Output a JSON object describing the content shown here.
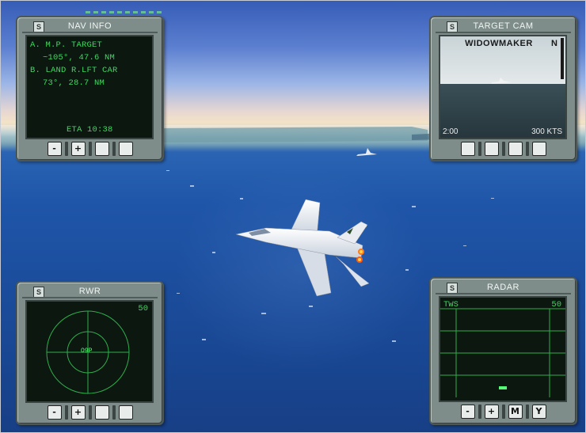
{
  "hud": {
    "nav_info": {
      "title": "NAV INFO",
      "panel_key": "S",
      "line_a1": "A. M.P. TARGET",
      "line_a2": "~105°, 47.6 NM",
      "line_b1": "B. LAND R.LFT CAR",
      "line_b2": "73°, 28.7 NM",
      "eta": "ETA 10:38",
      "buttons": [
        "-",
        "+",
        "",
        ""
      ]
    },
    "target_cam": {
      "title": "TARGET CAM",
      "panel_key": "S",
      "target_name": "WIDOWMAKER",
      "heading_marker": "N",
      "time": "2:00",
      "speed": "300 KTS",
      "buttons": [
        "",
        "",
        "",
        ""
      ]
    },
    "rwr": {
      "title": "RWR",
      "panel_key": "S",
      "range": "50",
      "contact_label": "O9P",
      "buttons": [
        "-",
        "+",
        "",
        ""
      ]
    },
    "radar": {
      "title": "RADAR",
      "panel_key": "S",
      "mode": "TWS",
      "range": "50",
      "buttons": [
        "-",
        "+",
        "M",
        "Y"
      ]
    }
  },
  "colors": {
    "display_green": "#3fd860",
    "panel_gray": "#7e8d89",
    "sea_blue": "#1f55a8"
  }
}
